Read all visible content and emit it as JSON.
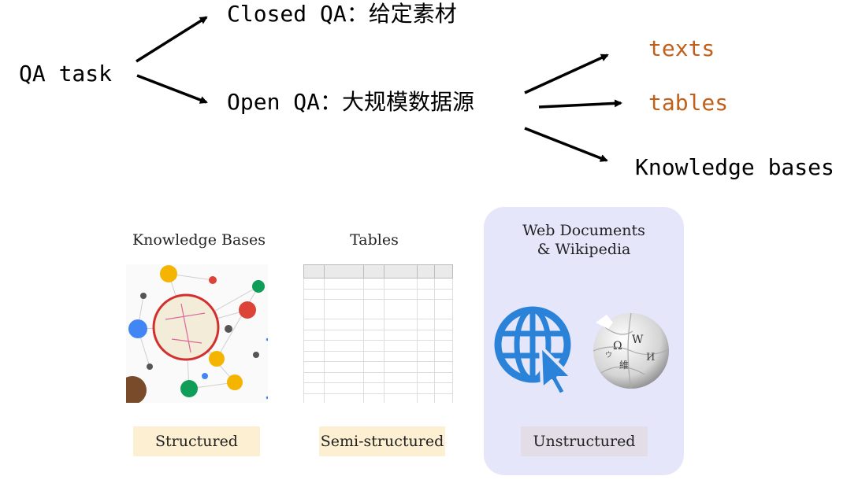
{
  "diagram": {
    "root": "QA task",
    "closed_qa": "Closed QA：给定素材",
    "open_qa": "Open QA：大规模数据源",
    "sources": [
      "texts",
      "tables",
      "Knowledge bases"
    ]
  },
  "panels": {
    "knowledge_bases": {
      "title": "Knowledge Bases",
      "badge": "Structured"
    },
    "tables": {
      "title": "Tables",
      "badge": "Semi-structured"
    },
    "web": {
      "title_line1": "Web Documents",
      "title_line2": "& Wikipedia",
      "badge": "Unstructured"
    }
  },
  "colors": {
    "source_text": "#c0601a",
    "panel_bg": "#e6e6fb",
    "badge_warm": "#fcefd2",
    "badge_grey": "#e2dde6",
    "web_icon": "#2b82d9"
  },
  "icons": [
    "web-globe-cursor-icon",
    "wikipedia-globe-icon"
  ]
}
